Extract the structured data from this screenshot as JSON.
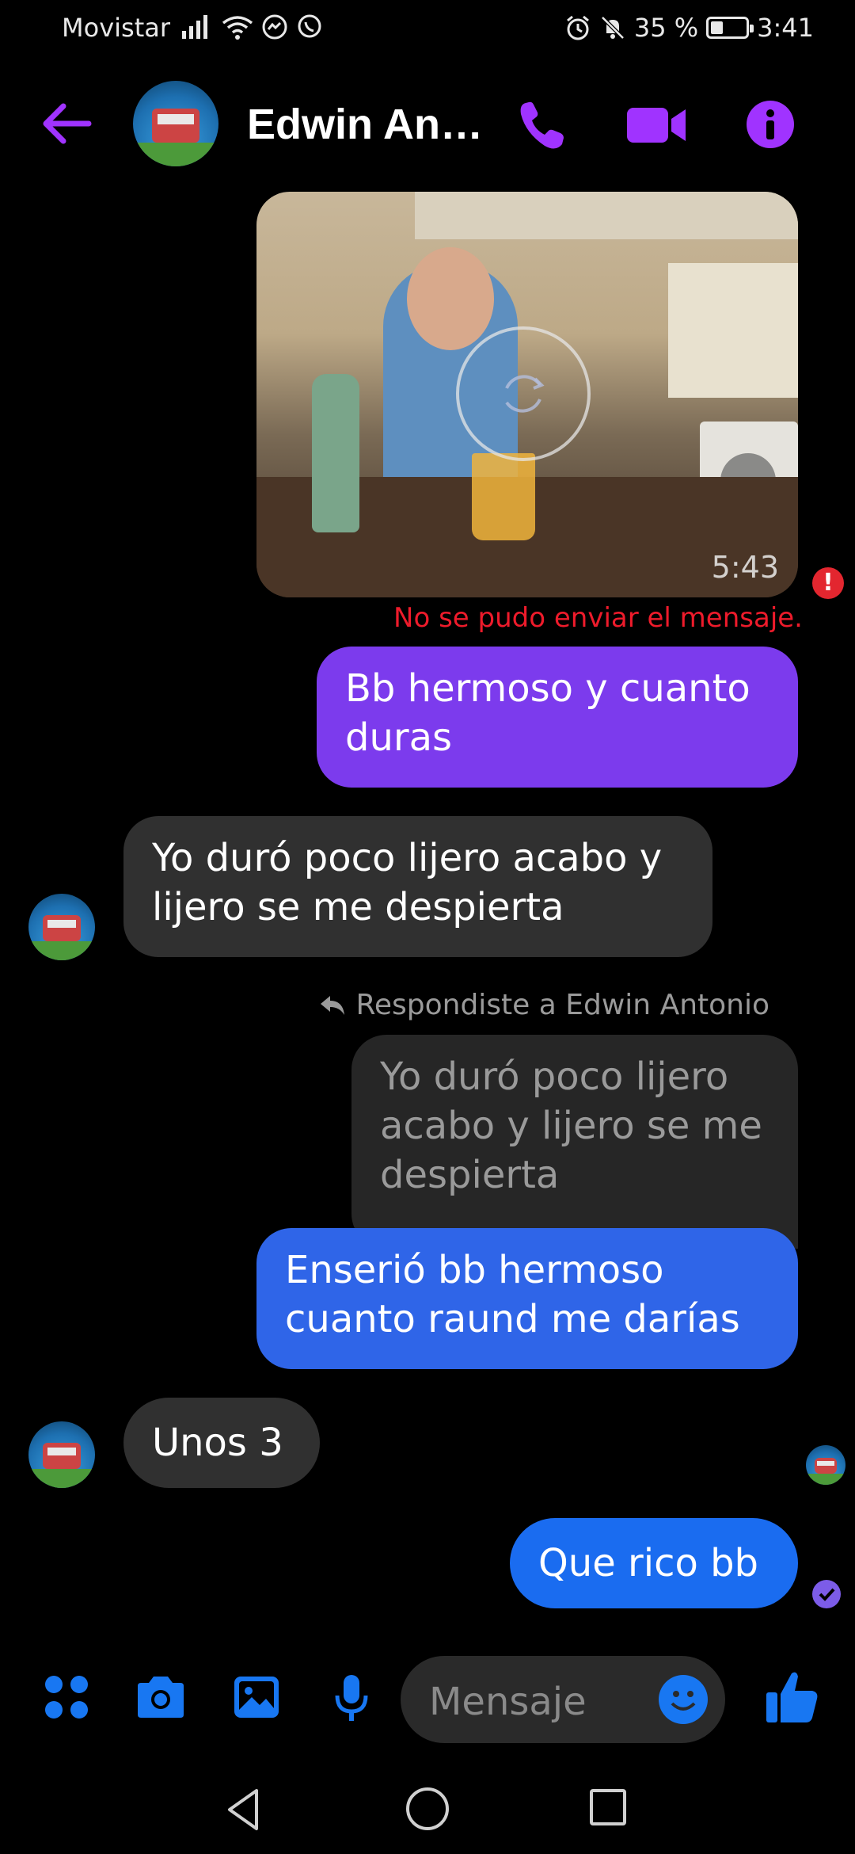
{
  "status_bar": {
    "carrier": "Movistar",
    "battery": "35 %",
    "battery_level": 0.35,
    "time": "3:41"
  },
  "header": {
    "contact_name": "Edwin An…",
    "icons": [
      "back-arrow-icon",
      "phone-icon",
      "video-camera-icon",
      "info-icon"
    ],
    "accent_color": "#a033ff"
  },
  "messages": {
    "video": {
      "duration": "5:43",
      "error": "No se pudo enviar el mensaje."
    },
    "m1": "Bb hermoso y cuanto duras",
    "m2": "Yo duró poco lijero acabo y lijero se me despierta",
    "reply_label": "Respondiste a Edwin Antonio",
    "quoted": "Yo duró poco lijero acabo y lijero se me despierta",
    "m3": "Enserió bb hermoso cuanto raund me darías",
    "m4": "Unos 3",
    "m5": "Que rico bb"
  },
  "colors": {
    "sent_purple": "#7c3bed",
    "sent_blue": "#2f65e8",
    "received": "#303030",
    "error_red": "#ee1b2b",
    "composer_blue": "#1877f2"
  },
  "composer": {
    "placeholder": "Mensaje",
    "icons": [
      "apps-icon",
      "camera-icon",
      "gallery-icon",
      "microphone-icon",
      "emoji-icon",
      "thumbs-up-icon"
    ]
  }
}
